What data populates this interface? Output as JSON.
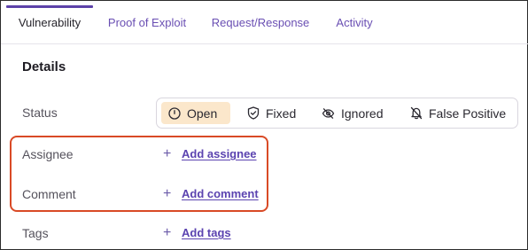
{
  "tabs": [
    {
      "label": "Vulnerability",
      "active": true
    },
    {
      "label": "Proof of Exploit",
      "active": false
    },
    {
      "label": "Request/Response",
      "active": false
    },
    {
      "label": "Activity",
      "active": false
    }
  ],
  "details": {
    "title": "Details",
    "status": {
      "label": "Status",
      "options": [
        {
          "label": "Open",
          "icon": "clock-icon",
          "selected": true
        },
        {
          "label": "Fixed",
          "icon": "shield-check-icon",
          "selected": false
        },
        {
          "label": "Ignored",
          "icon": "eye-off-icon",
          "selected": false
        },
        {
          "label": "False Positive",
          "icon": "bell-off-icon",
          "selected": false
        }
      ]
    },
    "assignee": {
      "label": "Assignee",
      "action": "Add assignee"
    },
    "comment": {
      "label": "Comment",
      "action": "Add comment"
    },
    "tags": {
      "label": "Tags",
      "action": "Add tags"
    },
    "plus_glyph": "+"
  },
  "colors": {
    "accent": "#5b43b0",
    "tab_indicator": "#5d42a9",
    "selected_status_bg": "#fbe7cb",
    "highlight_border": "#d94a26"
  }
}
